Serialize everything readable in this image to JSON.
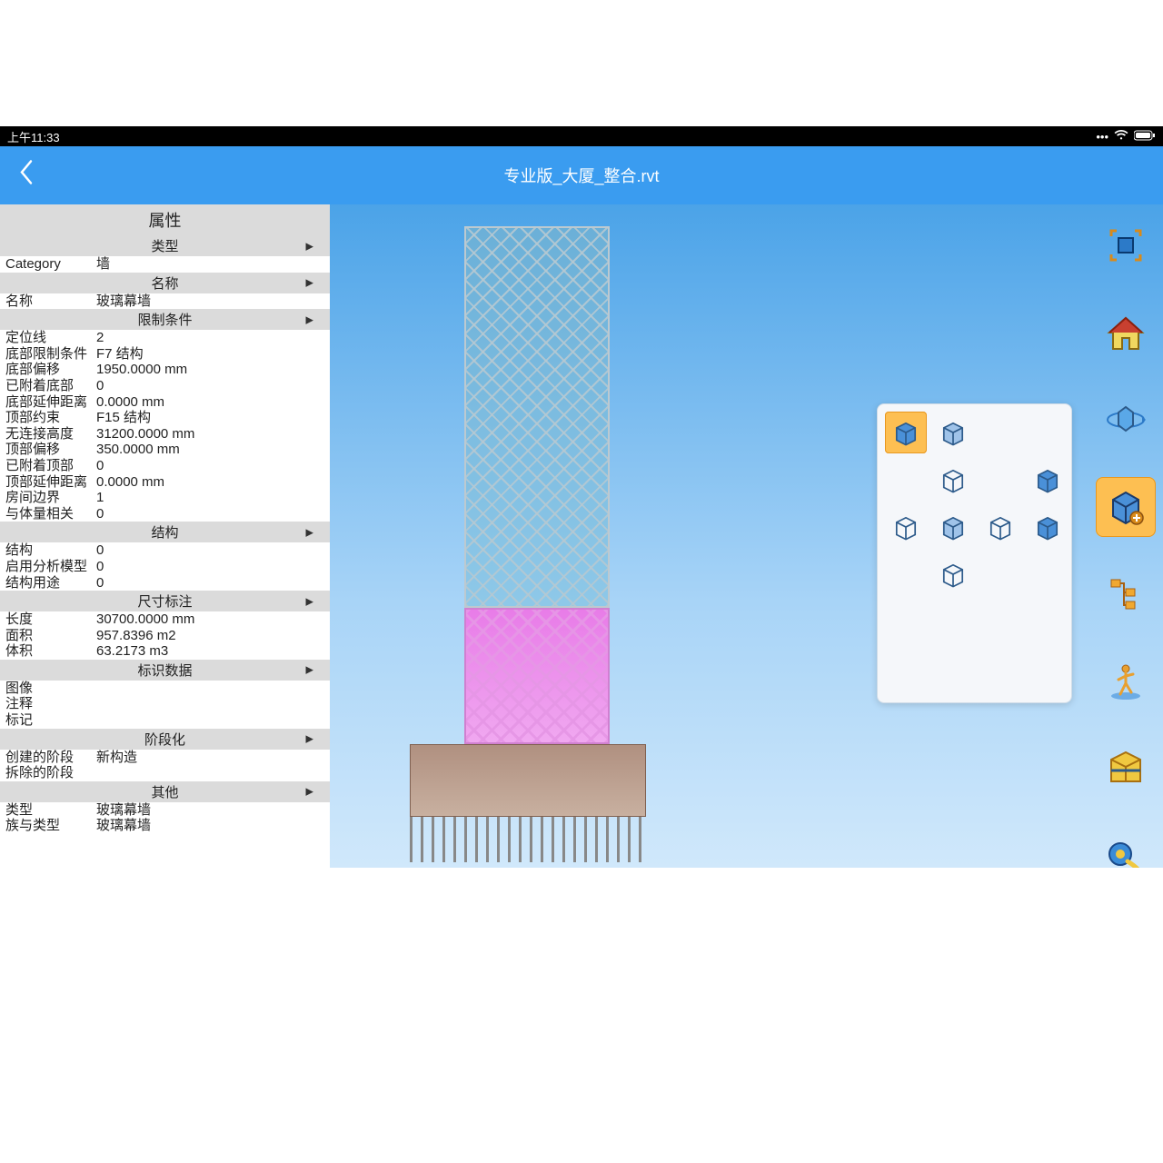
{
  "status_bar": {
    "time": "上午11:33",
    "icons": {
      "more": "•••",
      "wifi": "wifi",
      "battery": "battery"
    }
  },
  "title_bar": {
    "filename": "专业版_大厦_整合.rvt"
  },
  "properties": {
    "panel_title": "属性",
    "sections": {
      "type": {
        "header": "类型",
        "rows": [
          {
            "label": "Category",
            "value": "墙"
          }
        ]
      },
      "name": {
        "header": "名称",
        "rows": [
          {
            "label": "名称",
            "value": "玻璃幕墙"
          }
        ]
      },
      "constraints": {
        "header": "限制条件",
        "rows": [
          {
            "label": "定位线",
            "value": "2"
          },
          {
            "label": "底部限制条件",
            "value": "F7  结构"
          },
          {
            "label": "底部偏移",
            "value": "1950.0000 mm"
          },
          {
            "label": "已附着底部",
            "value": "0"
          },
          {
            "label": "底部延伸距离",
            "value": "0.0000 mm"
          },
          {
            "label": "顶部约束",
            "value": "F15 结构"
          },
          {
            "label": "无连接高度",
            "value": "31200.0000 mm"
          },
          {
            "label": "顶部偏移",
            "value": "350.0000 mm"
          },
          {
            "label": "已附着顶部",
            "value": "0"
          },
          {
            "label": "顶部延伸距离",
            "value": "0.0000 mm"
          },
          {
            "label": "房间边界",
            "value": "1"
          },
          {
            "label": "与体量相关",
            "value": "0"
          }
        ]
      },
      "structure": {
        "header": "结构",
        "rows": [
          {
            "label": "结构",
            "value": "0"
          },
          {
            "label": "启用分析模型",
            "value": "0"
          },
          {
            "label": "结构用途",
            "value": "0"
          }
        ]
      },
      "dimensions": {
        "header": "尺寸标注",
        "rows": [
          {
            "label": "长度",
            "value": "30700.0000 mm"
          },
          {
            "label": "面积",
            "value": "957.8396 m2"
          },
          {
            "label": "体积",
            "value": "63.2173 m3"
          }
        ]
      },
      "identity": {
        "header": "标识数据",
        "rows": [
          {
            "label": "图像",
            "value": ""
          },
          {
            "label": "注释",
            "value": ""
          },
          {
            "label": "标记",
            "value": ""
          }
        ]
      },
      "phasing": {
        "header": "阶段化",
        "rows": [
          {
            "label": "创建的阶段",
            "value": "新构造"
          },
          {
            "label": "拆除的阶段",
            "value": ""
          }
        ]
      },
      "other": {
        "header": "其他",
        "rows": [
          {
            "label": "类型",
            "value": "玻璃幕墙"
          },
          {
            "label": "族与类型",
            "value": "玻璃幕墙"
          }
        ]
      }
    }
  },
  "toolbar": {
    "items": [
      {
        "name": "fullscreen-icon"
      },
      {
        "name": "home-icon"
      },
      {
        "name": "orbit-icon"
      },
      {
        "name": "visual-style-icon",
        "active": true
      },
      {
        "name": "tree-icon"
      },
      {
        "name": "walk-icon"
      },
      {
        "name": "section-icon"
      },
      {
        "name": "measure-icon"
      },
      {
        "name": "checklist-icon"
      },
      {
        "name": "camera-icon"
      }
    ]
  },
  "visual_style_popup": {
    "options": [
      {
        "name": "shaded-solid",
        "selected": true,
        "row": 0,
        "col": 0
      },
      {
        "name": "shaded-transparent",
        "row": 0,
        "col": 1
      },
      {
        "name": "wireframe",
        "row": 1,
        "col": 1
      },
      {
        "name": "solid-blue",
        "row": 1,
        "col": 3
      },
      {
        "name": "wire-dark",
        "row": 2,
        "col": 0
      },
      {
        "name": "shaded-light",
        "row": 2,
        "col": 1
      },
      {
        "name": "hidden-line",
        "row": 2,
        "col": 2
      },
      {
        "name": "realistic",
        "row": 2,
        "col": 3
      },
      {
        "name": "ghost",
        "row": 3,
        "col": 1
      }
    ]
  }
}
